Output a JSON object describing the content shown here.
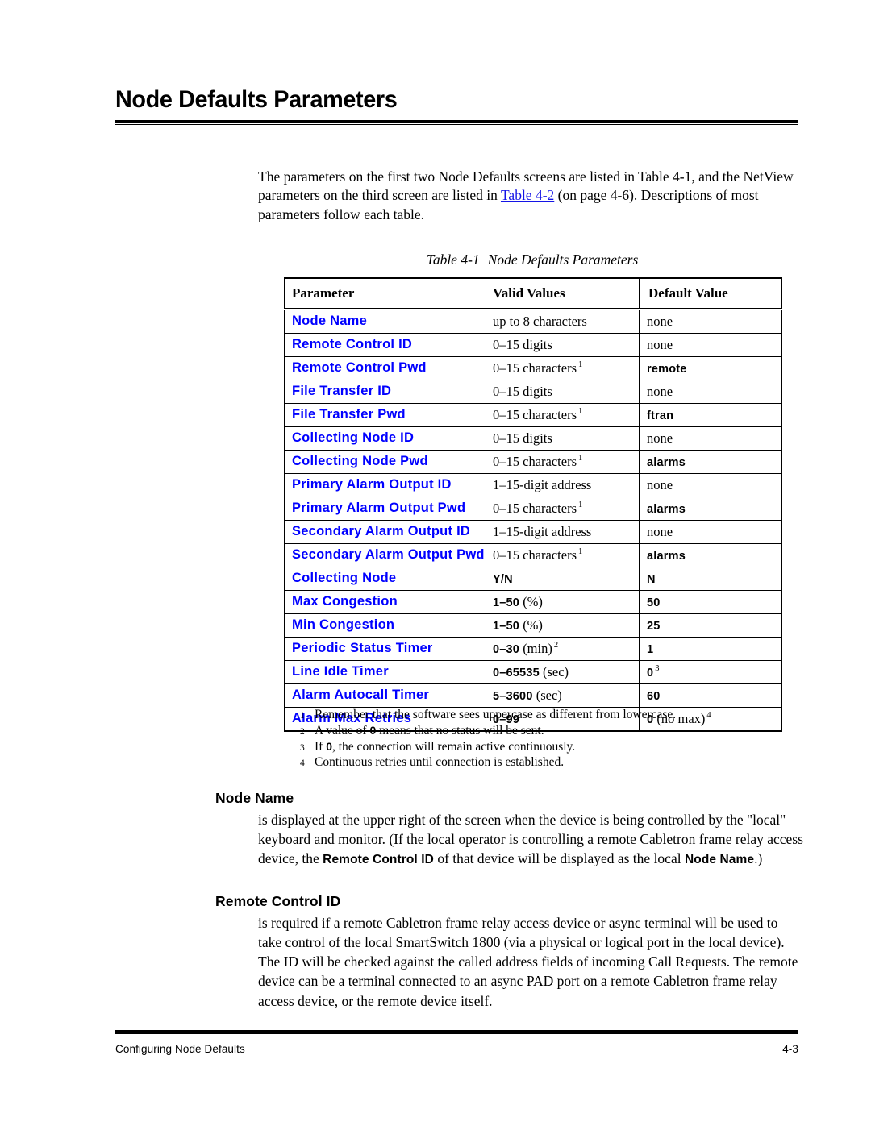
{
  "page": {
    "title": "Node Defaults Parameters",
    "intro_parts": {
      "before_link": "The parameters on the first two Node Defaults screens are listed in Table 4-1, and the NetView parameters on the third screen are listed in ",
      "link": "Table 4-2",
      "after_link": " (on page 4-6). Descriptions of most parameters follow each table."
    }
  },
  "table": {
    "caption_number": "Table 4-1",
    "caption_text": "Node Defaults Parameters",
    "headers": [
      "Parameter",
      "Valid Values",
      "Default Value"
    ],
    "rows": [
      {
        "parameter": "Node Name",
        "valid": "up to 8 characters",
        "valid_bold": "",
        "valid_rest": "",
        "valid_fn": "",
        "default": "none",
        "default_bold": false,
        "default_rest": "",
        "default_fn": ""
      },
      {
        "parameter": "Remote Control ID",
        "valid": "0–15 digits",
        "valid_bold": "",
        "valid_rest": "",
        "valid_fn": "",
        "default": "none",
        "default_bold": false,
        "default_rest": "",
        "default_fn": ""
      },
      {
        "parameter": "Remote Control Pwd",
        "valid": "0–15 characters",
        "valid_bold": "",
        "valid_rest": "",
        "valid_fn": "1",
        "default": "remote",
        "default_bold": true,
        "default_rest": "",
        "default_fn": ""
      },
      {
        "parameter": "File Transfer ID",
        "valid": "0–15 digits",
        "valid_bold": "",
        "valid_rest": "",
        "valid_fn": "",
        "default": "none",
        "default_bold": false,
        "default_rest": "",
        "default_fn": ""
      },
      {
        "parameter": "File Transfer Pwd",
        "valid": "0–15 characters",
        "valid_bold": "",
        "valid_rest": "",
        "valid_fn": "1",
        "default": "ftran",
        "default_bold": true,
        "default_rest": "",
        "default_fn": ""
      },
      {
        "parameter": "Collecting Node ID",
        "valid": "0–15 digits",
        "valid_bold": "",
        "valid_rest": "",
        "valid_fn": "",
        "default": "none",
        "default_bold": false,
        "default_rest": "",
        "default_fn": ""
      },
      {
        "parameter": "Collecting Node Pwd",
        "valid": "0–15 characters",
        "valid_bold": "",
        "valid_rest": "",
        "valid_fn": "1",
        "default": "alarms",
        "default_bold": true,
        "default_rest": "",
        "default_fn": ""
      },
      {
        "parameter": "Primary Alarm Output ID",
        "valid": "1–15-digit address",
        "valid_bold": "",
        "valid_rest": "",
        "valid_fn": "",
        "default": "none",
        "default_bold": false,
        "default_rest": "",
        "default_fn": ""
      },
      {
        "parameter": "Primary Alarm Output Pwd",
        "valid": "0–15 characters",
        "valid_bold": "",
        "valid_rest": "",
        "valid_fn": "1",
        "default": "alarms",
        "default_bold": true,
        "default_rest": "",
        "default_fn": ""
      },
      {
        "parameter": "Secondary Alarm Output ID",
        "valid": "1–15-digit address",
        "valid_bold": "",
        "valid_rest": "",
        "valid_fn": "",
        "default": "none",
        "default_bold": false,
        "default_rest": "",
        "default_fn": ""
      },
      {
        "parameter": "Secondary Alarm Output Pwd",
        "valid": "0–15 characters",
        "valid_bold": "",
        "valid_rest": "",
        "valid_fn": "1",
        "default": "alarms",
        "default_bold": true,
        "default_rest": "",
        "default_fn": ""
      },
      {
        "parameter": "Collecting Node",
        "valid": "",
        "valid_bold": "Y/N",
        "valid_rest": "",
        "valid_fn": "",
        "default": "",
        "default_bold": true,
        "default_rest": "",
        "default_fn": "",
        "default_b": "N"
      },
      {
        "parameter": "Max Congestion",
        "valid": "",
        "valid_bold": "1–50",
        "valid_rest": " (%)",
        "valid_fn": "",
        "default": "",
        "default_bold": true,
        "default_rest": "",
        "default_fn": "",
        "default_b": "50"
      },
      {
        "parameter": "Min Congestion",
        "valid": "",
        "valid_bold": "1–50",
        "valid_rest": " (%)",
        "valid_fn": "",
        "default": "",
        "default_bold": true,
        "default_rest": "",
        "default_fn": "",
        "default_b": "25"
      },
      {
        "parameter": "Periodic Status Timer",
        "valid": "",
        "valid_bold": "0–30",
        "valid_rest": " (min)",
        "valid_fn": "2",
        "default": "",
        "default_bold": true,
        "default_rest": "",
        "default_fn": "",
        "default_b": "1"
      },
      {
        "parameter": "Line Idle Timer",
        "valid": "",
        "valid_bold": "0–65535",
        "valid_rest": " (sec)",
        "valid_fn": "",
        "default": "",
        "default_bold": true,
        "default_rest": "",
        "default_fn": "3",
        "default_b": "0"
      },
      {
        "parameter": "Alarm Autocall Timer",
        "valid": "",
        "valid_bold": "5–3600",
        "valid_rest": " (sec)",
        "valid_fn": "",
        "default": "",
        "default_bold": true,
        "default_rest": "",
        "default_fn": "",
        "default_b": "60"
      },
      {
        "parameter": "Alarm Max Retries",
        "valid": "",
        "valid_bold": "0–99",
        "valid_rest": "",
        "valid_fn": "",
        "default": "",
        "default_bold": true,
        "default_rest": " (no max)",
        "default_fn": "4",
        "default_b": "0"
      }
    ],
    "footnotes": [
      {
        "num": "1",
        "text_before": "Remember that the software sees uppercase as different from lowercase.",
        "bold": "",
        "text_after": ""
      },
      {
        "num": "2",
        "text_before": "A value of ",
        "bold": "0",
        "text_after": " means that no status will be sent."
      },
      {
        "num": "3",
        "text_before": "If ",
        "bold": "0",
        "text_after": ", the connection will remain active continuously."
      },
      {
        "num": "4",
        "text_before": "Continuous retries until connection is established.",
        "bold": "",
        "text_after": ""
      }
    ]
  },
  "sections": [
    {
      "heading": "Node Name",
      "body_1": "is displayed at the upper right of the screen when the device is being controlled by the \"local\" keyboard and monitor. (If the local operator is controlling a remote Cabletron frame relay access device, the ",
      "bold_1": "Remote Control ID",
      "body_2": " of that device will be displayed as the local ",
      "bold_2": "Node Name",
      "body_3": ".)"
    },
    {
      "heading": "Remote Control ID",
      "body_1": "is required if a remote Cabletron frame relay access device or async terminal will be used to take control of the local SmartSwitch 1800 (via a physical or logical port in the local device). The ID will be checked against the called address fields of incoming Call Requests. The remote device can be a terminal connected to an async PAD port on a remote Cabletron frame relay access device, or the remote device itself.",
      "bold_1": "",
      "body_2": "",
      "bold_2": "",
      "body_3": ""
    }
  ],
  "footer": {
    "left": "Configuring Node Defaults",
    "right": "4-3"
  },
  "colors": {
    "link": "#1414e6",
    "param_blue": "#0000ff",
    "text": "#000000",
    "background": "#ffffff"
  }
}
